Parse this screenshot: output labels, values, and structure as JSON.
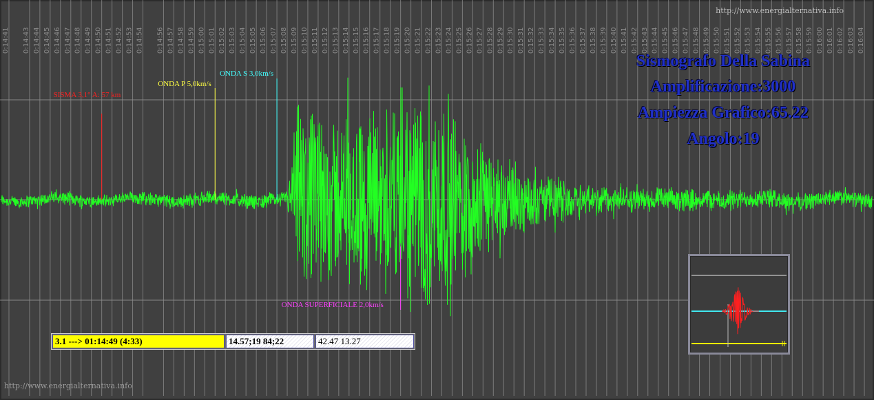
{
  "chart_data": {
    "type": "line",
    "title_lines": [
      "Sismografo Della Sabina",
      "Amplificazione:3000",
      "Ampiezza Grafico:65.22",
      "Angolo:19"
    ],
    "time_ticks": [
      "0:14:41",
      "0:14:43",
      "0:14:44",
      "0:14:45",
      "0:14:46",
      "0:14:47",
      "0:14:48",
      "0:14:49",
      "0:14:50",
      "0:14:51",
      "0:14:52",
      "0:14:53",
      "0:14:54",
      "0:14:56",
      "0:14:57",
      "0:14:58",
      "0:14:59",
      "0:15:00",
      "0:15:01",
      "0:15:02",
      "0:15:03",
      "0:15:04",
      "0:15:05",
      "0:15:06",
      "0:15:07",
      "0:15:08",
      "0:15:09",
      "0:15:10",
      "0:15:11",
      "0:15:12",
      "0:15:13",
      "0:15:14",
      "0:15:15",
      "0:15:16",
      "0:15:17",
      "0:15:18",
      "0:15:19",
      "0:15:20",
      "0:15:21",
      "0:15:22",
      "0:15:23",
      "0:15:24",
      "0:15:25",
      "0:15:26",
      "0:15:27",
      "0:15:28",
      "0:15:29",
      "0:15:30",
      "0:15:31",
      "0:15:32",
      "0:15:33",
      "0:15:34",
      "0:15:35",
      "0:15:36",
      "0:15:37",
      "0:15:38",
      "0:15:39",
      "0:15:40",
      "0:15:41",
      "0:15:42",
      "0:15:43",
      "0:15:44",
      "0:15:45",
      "0:15:46",
      "0:15:47",
      "0:15:48",
      "0:15:49",
      "0:15:50",
      "0:15:51",
      "0:15:52",
      "0:15:53",
      "0:15:54",
      "0:15:55",
      "0:15:56",
      "0:15:57",
      "0:15:58",
      "0:15:59",
      "0:16:00",
      "0:16:01",
      "0:16:02",
      "0:16:03",
      "0:16:04"
    ],
    "markers": [
      {
        "label": "SISMA 3,1° A: 57 km",
        "color": "#ff2020",
        "time": "0:14:50"
      },
      {
        "label": "ONDA P 5,0km/s",
        "color": "#ffff40",
        "time": "0:15:01"
      },
      {
        "label": "ONDA S 3,0km/s",
        "color": "#40ffff",
        "time": "0:15:07"
      },
      {
        "label": "ONDA SUPERFICIALE 2,0km/s",
        "color": "#ff40ff",
        "time": "0:15:19"
      }
    ],
    "trace": {
      "color": "#22ff22",
      "baseline_noise": 0.06,
      "envelope": [
        [
          "0:14:41",
          0.06
        ],
        [
          "0:15:08",
          0.07
        ],
        [
          "0:15:09",
          0.9
        ],
        [
          "0:15:13",
          0.8
        ],
        [
          "0:15:17",
          0.9
        ],
        [
          "0:15:19",
          1.0
        ],
        [
          "0:15:22",
          1.1
        ],
        [
          "0:15:25",
          0.8
        ],
        [
          "0:15:28",
          0.45
        ],
        [
          "0:15:32",
          0.25
        ],
        [
          "0:15:40",
          0.12
        ],
        [
          "0:16:04",
          0.07
        ]
      ]
    },
    "grid": true
  },
  "status_bar": {
    "event": "3.1 ---> 01:14:49 (4:33)",
    "values": "14.57;19 84;22",
    "coords": "42.47 13.27"
  },
  "watermark_top": "http://www.energialternativa.info",
  "watermark_bottom": "http://www.energialternativa.info",
  "colors": {
    "background": "#404040",
    "grid": "#9a9a9a",
    "title": "#2030c8"
  }
}
